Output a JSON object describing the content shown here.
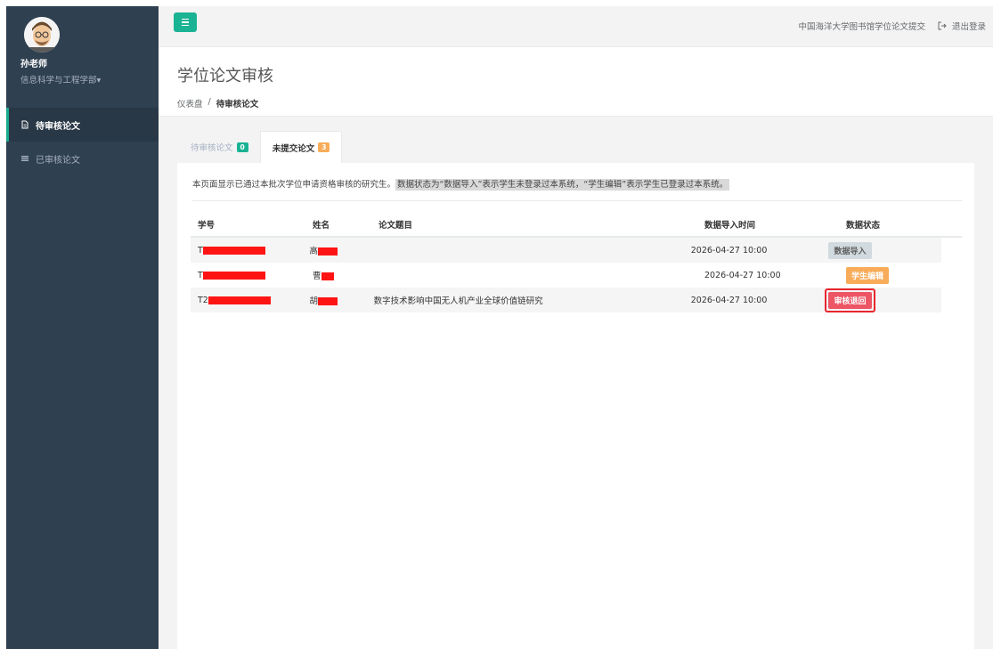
{
  "user": {
    "name": "孙老师",
    "department": "信息科学与工程学部",
    "dept_caret": "▾"
  },
  "nav": [
    {
      "label": "待审核论文",
      "icon": "document-icon",
      "active": true
    },
    {
      "label": "已审核论文",
      "icon": "list-icon",
      "active": false
    }
  ],
  "topbar": {
    "site_title": "中国海洋大学图书馆学位论文提交",
    "logout_label": "退出登录",
    "logout_icon": "sign-out-icon"
  },
  "page": {
    "title": "学位论文审核",
    "breadcrumb": {
      "home": "仪表盘",
      "separator": "/",
      "current": "待审核论文"
    }
  },
  "tabs": [
    {
      "label": "待审核论文",
      "badge": "0",
      "badge_color": "#1ab394",
      "active": false
    },
    {
      "label": "未提交论文",
      "badge": "3",
      "badge_color": "#f8ac59",
      "active": true
    }
  ],
  "notice": {
    "text": "本页面显示已通过本批次学位申请资格审核的研究生。",
    "highlight": "数据状态为“数据导入”表示学生未登录过本系统，“学生编辑”表示学生已登录过本系统。"
  },
  "table": {
    "columns": [
      "学号",
      "姓名",
      "论文题目",
      "数据导入时间",
      "数据状态"
    ],
    "rows": [
      {
        "id_prefix": "T",
        "name_prefix": "高",
        "title": "",
        "time": "2026-04-27 10:00",
        "status": "数据导入",
        "status_color": "#d1dade"
      },
      {
        "id_prefix": "T",
        "name_prefix": "曹",
        "title": "",
        "time": "2026-04-27 10:00",
        "status": "学生编辑",
        "status_color": "#f8ac59"
      },
      {
        "id_prefix": "T2",
        "name_prefix": "胡",
        "title": "数字技术影响中国无人机产业全球价值链研究",
        "time": "2026-04-27 10:00",
        "status": "审核退回",
        "status_color": "#ed5565"
      }
    ]
  },
  "colors": {
    "sidebar": "#2f4050",
    "accent": "#1ab394",
    "highlight_frame": "#e8262e"
  }
}
